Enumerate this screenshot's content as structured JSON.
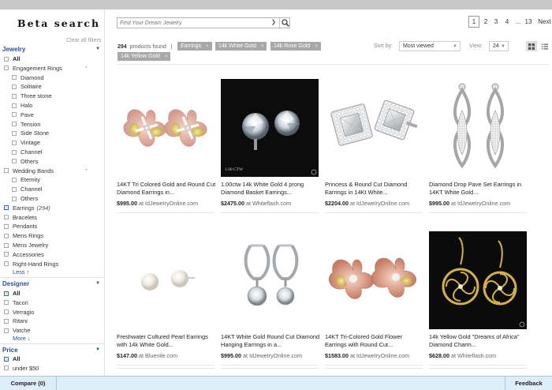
{
  "brand": "Beta search",
  "sidebar": {
    "clear_all": "Clear all filters",
    "jewelry_title": "Jewelry",
    "jewelry_items": [
      {
        "label": "All",
        "checked": false,
        "bold": true,
        "indent": 0
      },
      {
        "label": "Engagement Rings",
        "checked": false,
        "bold": false,
        "indent": 0,
        "expanded": "-"
      },
      {
        "label": "Diamond",
        "checked": false,
        "bold": false,
        "indent": 1
      },
      {
        "label": "Solitaire",
        "checked": false,
        "bold": false,
        "indent": 1
      },
      {
        "label": "Three stone",
        "checked": false,
        "bold": false,
        "indent": 1
      },
      {
        "label": "Halo",
        "checked": false,
        "bold": false,
        "indent": 1
      },
      {
        "label": "Pave",
        "checked": false,
        "bold": false,
        "indent": 1
      },
      {
        "label": "Tension",
        "checked": false,
        "bold": false,
        "indent": 1
      },
      {
        "label": "Side Stone",
        "checked": false,
        "bold": false,
        "indent": 1
      },
      {
        "label": "Vintage",
        "checked": false,
        "bold": false,
        "indent": 1
      },
      {
        "label": "Channel",
        "checked": false,
        "bold": false,
        "indent": 1
      },
      {
        "label": "Others",
        "checked": false,
        "bold": false,
        "indent": 1
      },
      {
        "label": "Wedding Bands",
        "checked": false,
        "bold": false,
        "indent": 0,
        "expanded": "-"
      },
      {
        "label": "Eternity",
        "checked": false,
        "bold": false,
        "indent": 1
      },
      {
        "label": "Channel",
        "checked": false,
        "bold": false,
        "indent": 1
      },
      {
        "label": "Others",
        "checked": false,
        "bold": false,
        "indent": 1
      },
      {
        "label": "Earrings",
        "checked": true,
        "bold": false,
        "indent": 0,
        "count": "(294)"
      },
      {
        "label": "Bracelets",
        "checked": false,
        "bold": false,
        "indent": 0
      },
      {
        "label": "Pendants",
        "checked": false,
        "bold": false,
        "indent": 0
      },
      {
        "label": "Mens Rings",
        "checked": false,
        "bold": false,
        "indent": 0
      },
      {
        "label": "Mens Jewelry",
        "checked": false,
        "bold": false,
        "indent": 0
      },
      {
        "label": "Accessories",
        "checked": false,
        "bold": false,
        "indent": 0
      },
      {
        "label": "Right-Hand Rings",
        "checked": false,
        "bold": false,
        "indent": 0
      }
    ],
    "jewelry_less": "Less ↑",
    "designer_title": "Designer",
    "designer_items": [
      {
        "label": "All",
        "checked": true,
        "bold": true
      },
      {
        "label": "Tacori",
        "checked": false,
        "bold": false
      },
      {
        "label": "Verragio",
        "checked": false,
        "bold": false
      },
      {
        "label": "Ritani",
        "checked": false,
        "bold": false
      },
      {
        "label": "Vatche",
        "checked": false,
        "bold": false
      }
    ],
    "designer_more": "More ↓",
    "price_title": "Price",
    "price_items": [
      {
        "label": "All",
        "checked": true,
        "bold": true
      },
      {
        "label": "under $50",
        "checked": false,
        "bold": false
      }
    ]
  },
  "search": {
    "placeholder": "Find Your Dream Jewelry"
  },
  "pagination": {
    "pages": [
      "1",
      "2",
      "3",
      "4",
      "...",
      "13"
    ],
    "current": "1",
    "next": "Next"
  },
  "results": {
    "count": "294",
    "found_label": "products found",
    "separator": "|"
  },
  "chips": [
    "Earrings",
    "14k White Gold",
    "14k Rose Gold",
    "14k Yellow Gold"
  ],
  "sort": {
    "label": "Sort by:",
    "value": "Most viewed"
  },
  "view": {
    "label": "View:",
    "value": "24"
  },
  "products": [
    {
      "title": "14KT Tri Colored Gold and Round Cut Diamond Earrings in...",
      "price": "$995.00",
      "at": "at",
      "store": "IdJeweIryOnline.com",
      "image": "flower-earrings-tricolor"
    },
    {
      "title": "1.00ctw 14k White Gold 4 prong Diamond Basket Earrings...",
      "price": "$2475.00",
      "at": "at",
      "store": "Whiteflash.com",
      "image": "diamond-studs-black",
      "caption": "1.00 CTW"
    },
    {
      "title": "Princess & Round Cut Diamond Earrings in 14Kt White...",
      "price": "$2204.00",
      "at": "at",
      "store": "IdJeweIryOnline.com",
      "image": "princess-cut-studs"
    },
    {
      "title": "Diamond Drop Pave Set Earrings in 14KT White Gold...",
      "price": "$995.00",
      "at": "at",
      "store": "IdJeweIryOnline.com",
      "image": "drop-pave-earrings"
    },
    {
      "title": "Freshwater Cultured Pearl Earrings with 14k White Gold...",
      "price": "$147.00",
      "at": "at",
      "store": "Bluenile.com",
      "image": "pearl-studs"
    },
    {
      "title": "14KT White Gold Round Cut Diamond Hanging Earrings in a...",
      "price": "$995.00",
      "at": "at",
      "store": "IdJeweIryOnline.com",
      "image": "hoop-drop-earrings"
    },
    {
      "title": "14KT Tri-Colored Gold Flower Earrings with Round Cut...",
      "price": "$1583.00",
      "at": "at",
      "store": "IdJeweIryOnline.com",
      "image": "flower-earrings-rose"
    },
    {
      "title": "14k Yellow Gold \"Dreams of Africa\" Diamond Charm...",
      "price": "$628.00",
      "at": "at",
      "store": "Whiteflash.com",
      "image": "gold-swirl-earrings-black"
    }
  ],
  "bottom": {
    "compare": "Compare (0)",
    "feedback": "Feedback"
  },
  "colors": {
    "accent": "#2a4f93",
    "chip": "#a8a8a8",
    "bottom_bar": "#ddeef9"
  }
}
